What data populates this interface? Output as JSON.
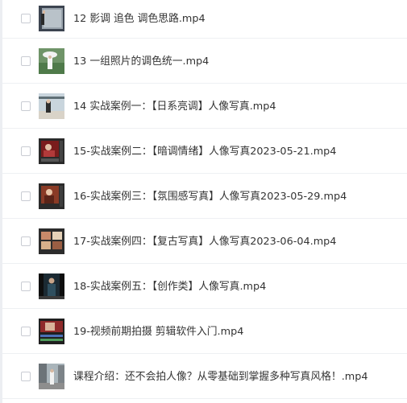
{
  "files": [
    {
      "name": "12 影调 追色 调色思路.mp4",
      "thumb": "portrait-window-thumbnail-icon"
    },
    {
      "name": "13 一组照片的调色统一.mp4",
      "thumb": "umbrella-portrait-thumbnail-icon"
    },
    {
      "name": "14 实战案例一：【日系亮调】人像写真.mp4",
      "thumb": "bright-portrait-thumbnail-icon"
    },
    {
      "name": "15-实战案例二：【暗调情绪】人像写真2023-05-21.mp4",
      "thumb": "editor-red-thumbnail-icon"
    },
    {
      "name": "16-实战案例三：【氛围感写真】人像写真2023-05-29.mp4",
      "thumb": "editor-warm-thumbnail-icon"
    },
    {
      "name": "17-实战案例四：【复古写真】人像写真2023-06-04.mp4",
      "thumb": "editor-grid-thumbnail-icon"
    },
    {
      "name": "18-实战案例五：【创作类】人像写真.mp4",
      "thumb": "dark-portrait-thumbnail-icon"
    },
    {
      "name": "19-视频前期拍摄 剪辑软件入门.mp4",
      "thumb": "video-editor-thumbnail-icon"
    },
    {
      "name": "课程介绍：还不会拍人像？从零基础到掌握多种写真风格！.mp4",
      "thumb": "street-portrait-thumbnail-icon"
    }
  ]
}
